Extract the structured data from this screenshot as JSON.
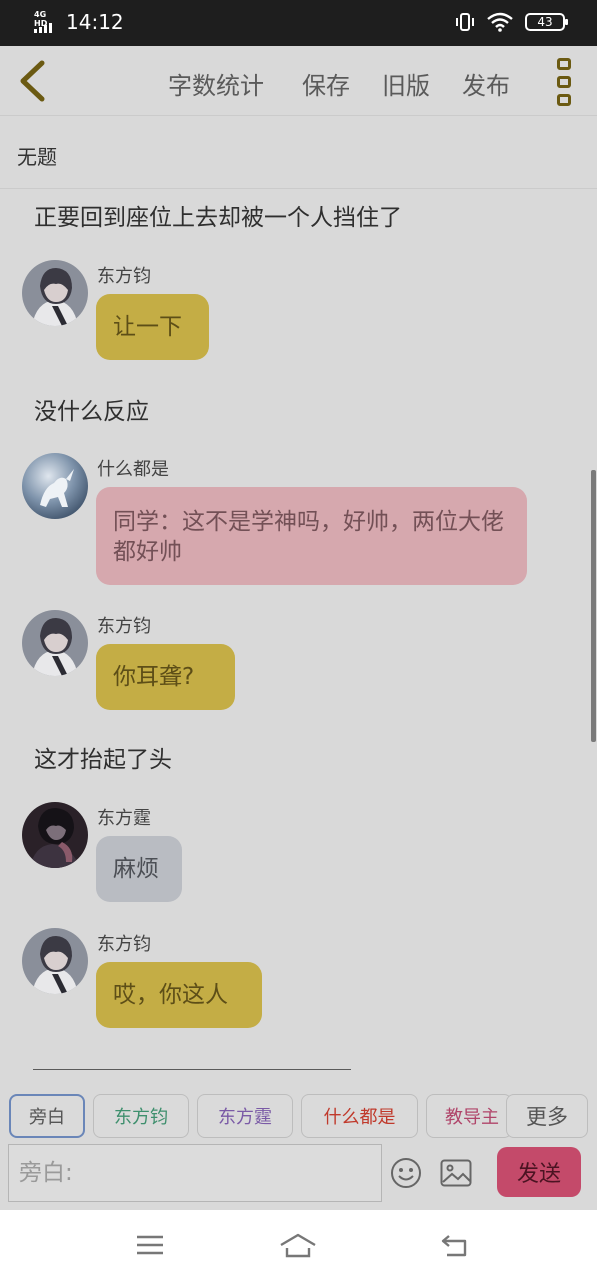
{
  "status_bar": {
    "network": "4G HD",
    "time": "14:12",
    "battery": "43"
  },
  "toolbar": {
    "word_count": "字数统计",
    "save": "保存",
    "old_version": "旧版",
    "publish": "发布"
  },
  "document": {
    "title": "无题"
  },
  "messages": [
    {
      "type": "narration",
      "text": "正要回到座位上去却被一个人挡住了"
    },
    {
      "type": "dialogue",
      "sender": "东方钧",
      "text": "让一下",
      "color": "#c4ad45"
    },
    {
      "type": "narration",
      "text": "没什么反应"
    },
    {
      "type": "dialogue",
      "sender": "什么都是",
      "text": "同学：这不是学神吗，好帅，两位大佬都好帅",
      "color": "#d6a8ae"
    },
    {
      "type": "dialogue",
      "sender": "东方钧",
      "text": "你耳聋?",
      "color": "#c4ad45"
    },
    {
      "type": "narration",
      "text": "这才抬起了头"
    },
    {
      "type": "dialogue",
      "sender": "东方霆",
      "text": "麻烦",
      "color": "#b9bcc2"
    },
    {
      "type": "dialogue",
      "sender": "东方钧",
      "text": "哎，你这人",
      "color": "#c4ad45"
    }
  ],
  "composer": {
    "roles": [
      {
        "name": "旁白",
        "color": "#555555"
      },
      {
        "name": "东方钧",
        "color": "#3e8f6d"
      },
      {
        "name": "东方霆",
        "color": "#7a5aa6"
      },
      {
        "name": "什么都是",
        "color": "#c0392b"
      },
      {
        "name": "教导主",
        "color": "#b0456a"
      }
    ],
    "more": "更多",
    "placeholder": "旁白:",
    "send": "发送"
  }
}
